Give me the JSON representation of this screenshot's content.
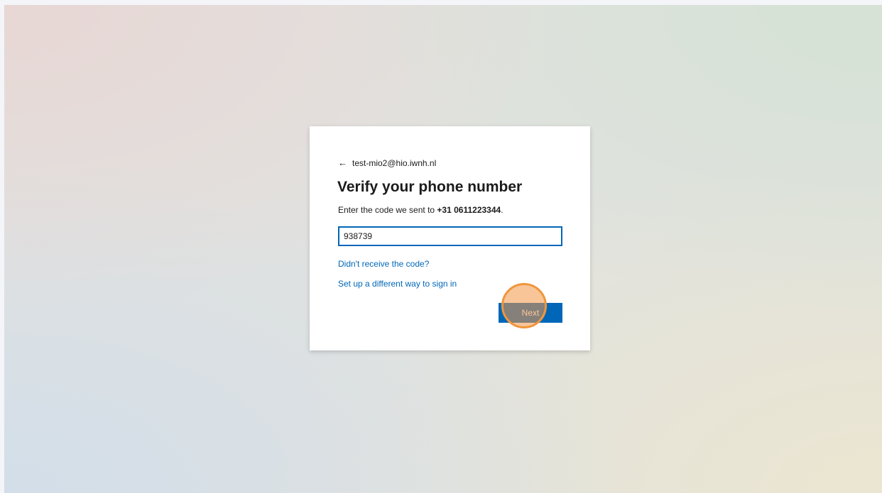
{
  "signin": {
    "identity": {
      "back_icon": "arrow-left-icon",
      "back_glyph": "←",
      "email": "test-mio2@hio.iwnh.nl"
    },
    "title": "Verify your phone number",
    "description": {
      "prefix": "Enter the code we sent to ",
      "phone": "+31 0611223344",
      "suffix": "."
    },
    "code_input": {
      "value": "938739"
    },
    "links": {
      "resend": "Didn't receive the code?",
      "alternative": "Set up a different way to sign in"
    },
    "next_label": "Next"
  },
  "colors": {
    "accent": "#0067b8",
    "text": "#1b1b1b",
    "highlight": "#f0963c"
  }
}
